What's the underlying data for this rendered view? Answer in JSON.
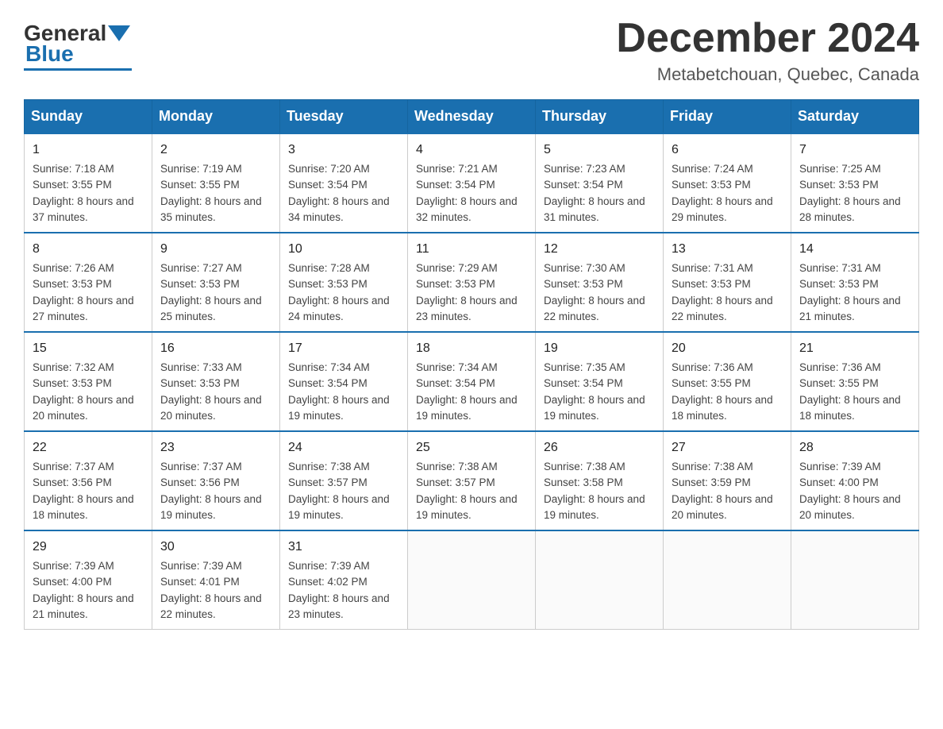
{
  "header": {
    "logo_general": "General",
    "logo_blue": "Blue",
    "month_title": "December 2024",
    "location": "Metabetchouan, Quebec, Canada"
  },
  "weekdays": [
    "Sunday",
    "Monday",
    "Tuesday",
    "Wednesday",
    "Thursday",
    "Friday",
    "Saturday"
  ],
  "weeks": [
    [
      {
        "day": "1",
        "sunrise": "7:18 AM",
        "sunset": "3:55 PM",
        "daylight": "8 hours and 37 minutes."
      },
      {
        "day": "2",
        "sunrise": "7:19 AM",
        "sunset": "3:55 PM",
        "daylight": "8 hours and 35 minutes."
      },
      {
        "day": "3",
        "sunrise": "7:20 AM",
        "sunset": "3:54 PM",
        "daylight": "8 hours and 34 minutes."
      },
      {
        "day": "4",
        "sunrise": "7:21 AM",
        "sunset": "3:54 PM",
        "daylight": "8 hours and 32 minutes."
      },
      {
        "day": "5",
        "sunrise": "7:23 AM",
        "sunset": "3:54 PM",
        "daylight": "8 hours and 31 minutes."
      },
      {
        "day": "6",
        "sunrise": "7:24 AM",
        "sunset": "3:53 PM",
        "daylight": "8 hours and 29 minutes."
      },
      {
        "day": "7",
        "sunrise": "7:25 AM",
        "sunset": "3:53 PM",
        "daylight": "8 hours and 28 minutes."
      }
    ],
    [
      {
        "day": "8",
        "sunrise": "7:26 AM",
        "sunset": "3:53 PM",
        "daylight": "8 hours and 27 minutes."
      },
      {
        "day": "9",
        "sunrise": "7:27 AM",
        "sunset": "3:53 PM",
        "daylight": "8 hours and 25 minutes."
      },
      {
        "day": "10",
        "sunrise": "7:28 AM",
        "sunset": "3:53 PM",
        "daylight": "8 hours and 24 minutes."
      },
      {
        "day": "11",
        "sunrise": "7:29 AM",
        "sunset": "3:53 PM",
        "daylight": "8 hours and 23 minutes."
      },
      {
        "day": "12",
        "sunrise": "7:30 AM",
        "sunset": "3:53 PM",
        "daylight": "8 hours and 22 minutes."
      },
      {
        "day": "13",
        "sunrise": "7:31 AM",
        "sunset": "3:53 PM",
        "daylight": "8 hours and 22 minutes."
      },
      {
        "day": "14",
        "sunrise": "7:31 AM",
        "sunset": "3:53 PM",
        "daylight": "8 hours and 21 minutes."
      }
    ],
    [
      {
        "day": "15",
        "sunrise": "7:32 AM",
        "sunset": "3:53 PM",
        "daylight": "8 hours and 20 minutes."
      },
      {
        "day": "16",
        "sunrise": "7:33 AM",
        "sunset": "3:53 PM",
        "daylight": "8 hours and 20 minutes."
      },
      {
        "day": "17",
        "sunrise": "7:34 AM",
        "sunset": "3:54 PM",
        "daylight": "8 hours and 19 minutes."
      },
      {
        "day": "18",
        "sunrise": "7:34 AM",
        "sunset": "3:54 PM",
        "daylight": "8 hours and 19 minutes."
      },
      {
        "day": "19",
        "sunrise": "7:35 AM",
        "sunset": "3:54 PM",
        "daylight": "8 hours and 19 minutes."
      },
      {
        "day": "20",
        "sunrise": "7:36 AM",
        "sunset": "3:55 PM",
        "daylight": "8 hours and 18 minutes."
      },
      {
        "day": "21",
        "sunrise": "7:36 AM",
        "sunset": "3:55 PM",
        "daylight": "8 hours and 18 minutes."
      }
    ],
    [
      {
        "day": "22",
        "sunrise": "7:37 AM",
        "sunset": "3:56 PM",
        "daylight": "8 hours and 18 minutes."
      },
      {
        "day": "23",
        "sunrise": "7:37 AM",
        "sunset": "3:56 PM",
        "daylight": "8 hours and 19 minutes."
      },
      {
        "day": "24",
        "sunrise": "7:38 AM",
        "sunset": "3:57 PM",
        "daylight": "8 hours and 19 minutes."
      },
      {
        "day": "25",
        "sunrise": "7:38 AM",
        "sunset": "3:57 PM",
        "daylight": "8 hours and 19 minutes."
      },
      {
        "day": "26",
        "sunrise": "7:38 AM",
        "sunset": "3:58 PM",
        "daylight": "8 hours and 19 minutes."
      },
      {
        "day": "27",
        "sunrise": "7:38 AM",
        "sunset": "3:59 PM",
        "daylight": "8 hours and 20 minutes."
      },
      {
        "day": "28",
        "sunrise": "7:39 AM",
        "sunset": "4:00 PM",
        "daylight": "8 hours and 20 minutes."
      }
    ],
    [
      {
        "day": "29",
        "sunrise": "7:39 AM",
        "sunset": "4:00 PM",
        "daylight": "8 hours and 21 minutes."
      },
      {
        "day": "30",
        "sunrise": "7:39 AM",
        "sunset": "4:01 PM",
        "daylight": "8 hours and 22 minutes."
      },
      {
        "day": "31",
        "sunrise": "7:39 AM",
        "sunset": "4:02 PM",
        "daylight": "8 hours and 23 minutes."
      },
      null,
      null,
      null,
      null
    ]
  ]
}
